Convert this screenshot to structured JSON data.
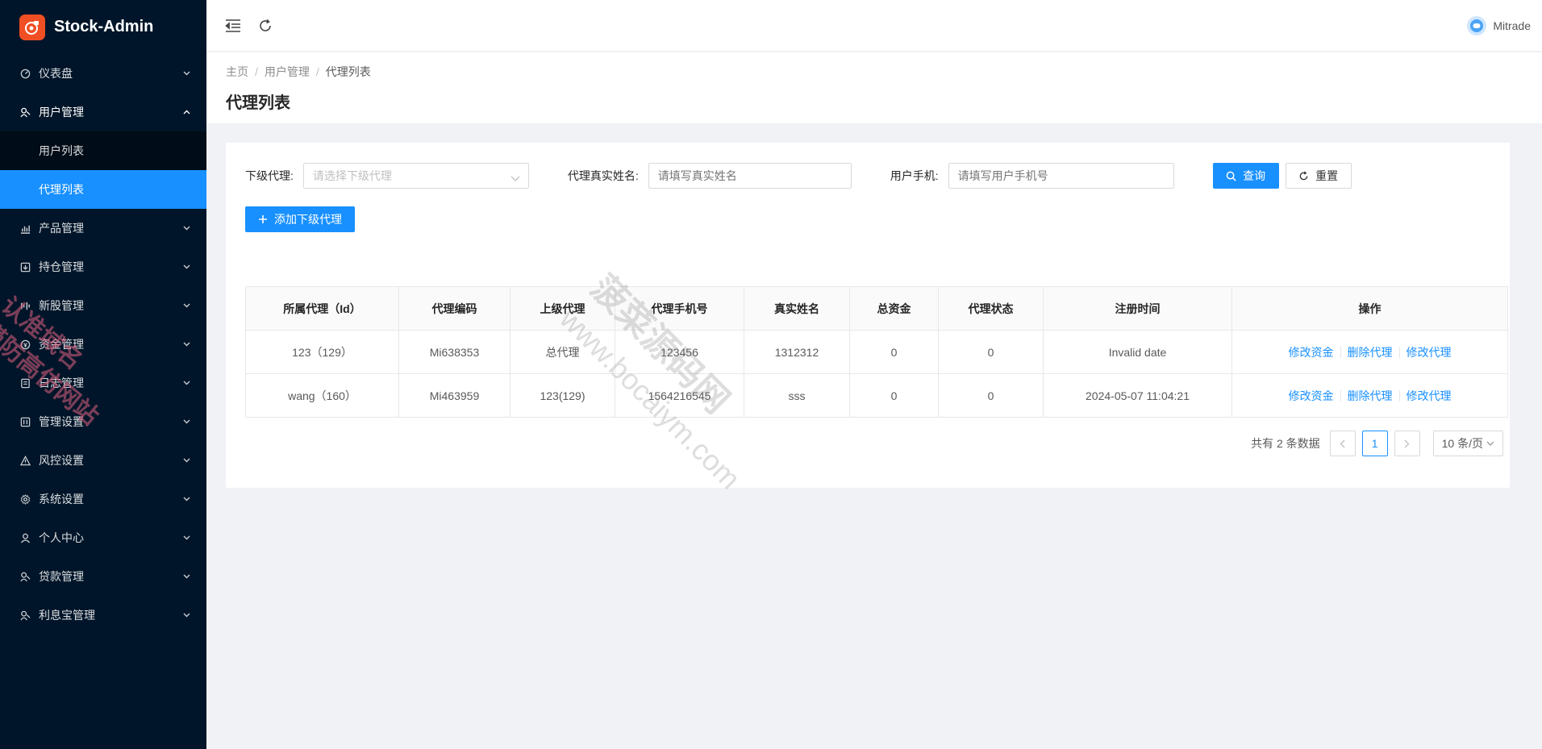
{
  "app": {
    "title": "Stock-Admin"
  },
  "sidebar": {
    "items": [
      {
        "label": "仪表盘",
        "icon": "dashboard-icon"
      },
      {
        "label": "用户管理",
        "icon": "user-manage-icon",
        "open": true,
        "children": [
          {
            "label": "用户列表"
          },
          {
            "label": "代理列表",
            "active": true
          }
        ]
      },
      {
        "label": "产品管理",
        "icon": "chart-icon"
      },
      {
        "label": "持仓管理",
        "icon": "position-icon"
      },
      {
        "label": "新股管理",
        "icon": "stock-icon"
      },
      {
        "label": "资金管理",
        "icon": "money-icon"
      },
      {
        "label": "日志管理",
        "icon": "log-icon"
      },
      {
        "label": "管理设置",
        "icon": "manage-settings-icon"
      },
      {
        "label": "风控设置",
        "icon": "warning-icon"
      },
      {
        "label": "系统设置",
        "icon": "gear-icon"
      },
      {
        "label": "个人中心",
        "icon": "person-icon"
      },
      {
        "label": "贷款管理",
        "icon": "loan-icon"
      },
      {
        "label": "利息宝管理",
        "icon": "interest-icon"
      }
    ]
  },
  "header": {
    "user_name": "Mitrade"
  },
  "page": {
    "breadcrumb": [
      "主页",
      "用户管理",
      "代理列表"
    ],
    "title": "代理列表"
  },
  "filters": {
    "sub_agent_label": "下级代理:",
    "sub_agent_placeholder": "请选择下级代理",
    "real_name_label": "代理真实姓名:",
    "real_name_placeholder": "请填写真实姓名",
    "phone_label": "用户手机:",
    "phone_placeholder": "请填写用户手机号",
    "search_label": "查询",
    "reset_label": "重置"
  },
  "add_button": "添加下级代理",
  "table": {
    "columns": [
      "所属代理（Id）",
      "代理编码",
      "上级代理",
      "代理手机号",
      "真实姓名",
      "总资金",
      "代理状态",
      "注册时间",
      "操作"
    ],
    "rows": [
      [
        "123（129）",
        "Mi638353",
        "总代理",
        "123456",
        "1312312",
        "0",
        "0",
        "Invalid date"
      ],
      [
        "wang（160）",
        "Mi463959",
        "123(129)",
        "1564216545",
        "sss",
        "0",
        "0",
        "2024-05-07 11:04:21"
      ]
    ],
    "actions": [
      "修改资金",
      "删除代理",
      "修改代理"
    ]
  },
  "pagination": {
    "total_text": "共有 2 条数据",
    "current_page": "1",
    "page_size": "10 条/页"
  },
  "watermarks": {
    "left_line1": "认准域名",
    "left_line2": "谨防高仿网站",
    "center_line1": "菠菜源码网",
    "center_line2": "www.bocaiym.com"
  },
  "colors": {
    "sidebar_bg": "#001529",
    "primary": "#1890ff",
    "logo": "#f04f23"
  }
}
